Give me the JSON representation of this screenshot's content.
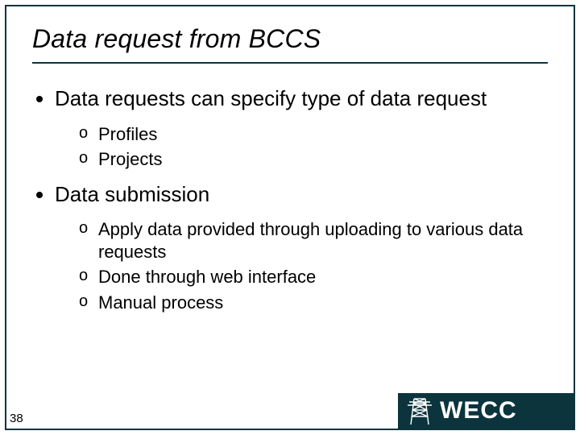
{
  "title": "Data request from BCCS",
  "bullets": {
    "0": {
      "text": "Data requests can specify type of data request",
      "sub": {
        "0": "Profiles",
        "1": "Projects"
      }
    },
    "1": {
      "text": "Data submission",
      "sub": {
        "0": "Apply data provided through uploading to various data requests",
        "1": "Done through web interface",
        "2": "Manual process"
      }
    }
  },
  "page_number": "38",
  "logo_text": "WECC"
}
